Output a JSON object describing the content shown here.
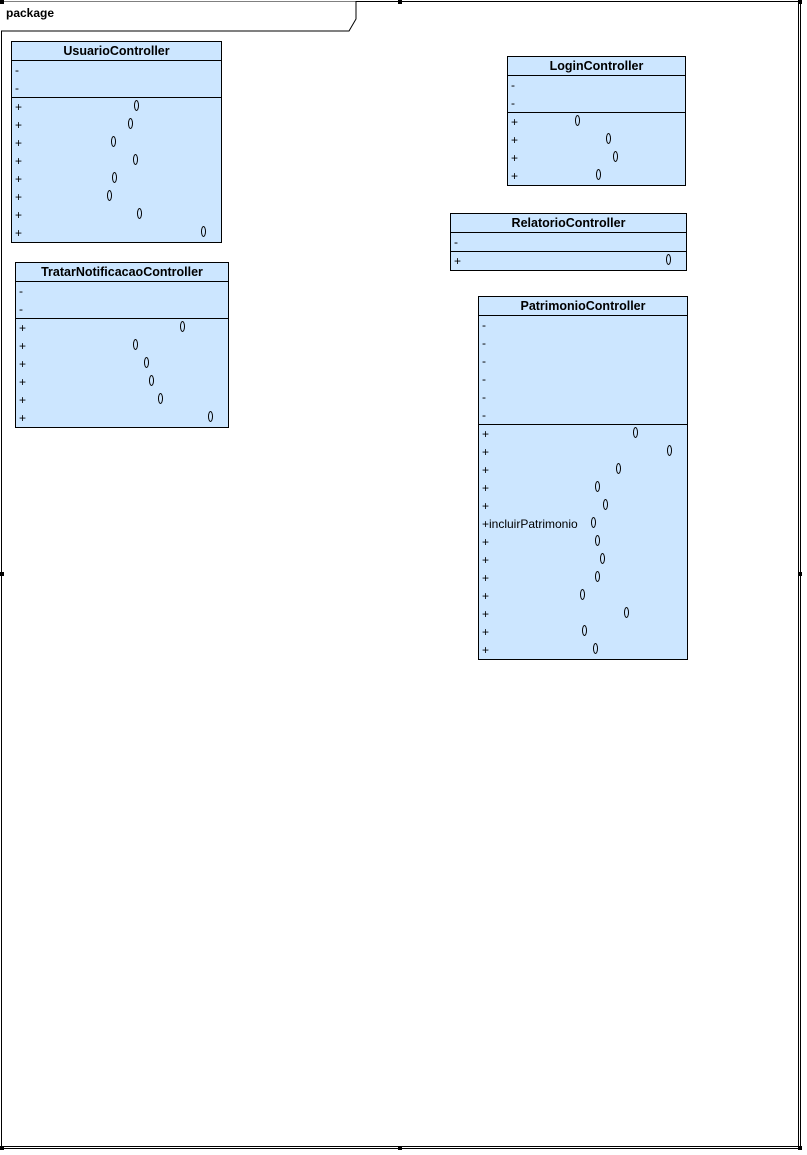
{
  "package": {
    "label": "package"
  },
  "colors": {
    "class_fill": "#cce6ff",
    "line": "#000000"
  },
  "classes": [
    {
      "name": "UsuarioController",
      "attributes": [
        {
          "vis": "-"
        },
        {
          "vis": "-"
        }
      ],
      "operations": [
        {
          "vis": "+",
          "text": "",
          "paren": "()"
        },
        {
          "vis": "+",
          "text": "",
          "paren": "()"
        },
        {
          "vis": "+",
          "text": "",
          "paren": "()"
        },
        {
          "vis": "+",
          "text": "",
          "paren": "()"
        },
        {
          "vis": "+",
          "text": "",
          "paren": "()"
        },
        {
          "vis": "+",
          "text": "",
          "paren": "()"
        },
        {
          "vis": "+",
          "text": "",
          "paren": "()"
        },
        {
          "vis": "+",
          "text": "",
          "paren": "()"
        }
      ]
    },
    {
      "name": "TratarNotificacaoController",
      "attributes": [
        {
          "vis": "-"
        },
        {
          "vis": "-"
        }
      ],
      "operations": [
        {
          "vis": "+",
          "text": "",
          "paren": "()"
        },
        {
          "vis": "+",
          "text": "",
          "paren": "()"
        },
        {
          "vis": "+",
          "text": "",
          "paren": "()"
        },
        {
          "vis": "+",
          "text": "",
          "paren": "()"
        },
        {
          "vis": "+",
          "text": "",
          "paren": "()"
        },
        {
          "vis": "+",
          "text": "",
          "paren": "()"
        }
      ]
    },
    {
      "name": "LoginController",
      "attributes": [
        {
          "vis": "-"
        },
        {
          "vis": "-"
        }
      ],
      "operations": [
        {
          "vis": "+",
          "text": "",
          "paren": "()"
        },
        {
          "vis": "+",
          "text": "",
          "paren": "()"
        },
        {
          "vis": "+",
          "text": "",
          "paren": "()"
        },
        {
          "vis": "+",
          "text": "",
          "paren": "()"
        }
      ]
    },
    {
      "name": "RelatorioController",
      "attributes": [
        {
          "vis": "-"
        }
      ],
      "operations": [
        {
          "vis": "+",
          "text": "",
          "paren": "()"
        }
      ]
    },
    {
      "name": "PatrimonioController",
      "attributes": [
        {
          "vis": "-"
        },
        {
          "vis": "-"
        },
        {
          "vis": "-"
        },
        {
          "vis": "-"
        },
        {
          "vis": "-"
        },
        {
          "vis": "-"
        }
      ],
      "operations": [
        {
          "vis": "+",
          "text": "",
          "paren": "()"
        },
        {
          "vis": "+",
          "text": "",
          "paren": "()"
        },
        {
          "vis": "+",
          "text": "",
          "paren": "()"
        },
        {
          "vis": "+",
          "text": "",
          "paren": "()"
        },
        {
          "vis": "+",
          "text": "",
          "paren": "()"
        },
        {
          "vis": "+",
          "text": "incluirPatrimonio",
          "paren": "()"
        },
        {
          "vis": "+",
          "text": "",
          "paren": "()"
        },
        {
          "vis": "+",
          "text": "",
          "paren": "()"
        },
        {
          "vis": "+",
          "text": "",
          "paren": "()"
        },
        {
          "vis": "+",
          "text": "",
          "paren": "()"
        },
        {
          "vis": "+",
          "text": "",
          "paren": "()"
        },
        {
          "vis": "+",
          "text": "",
          "paren": "()"
        },
        {
          "vis": "+",
          "text": "",
          "paren": "()"
        }
      ]
    }
  ]
}
